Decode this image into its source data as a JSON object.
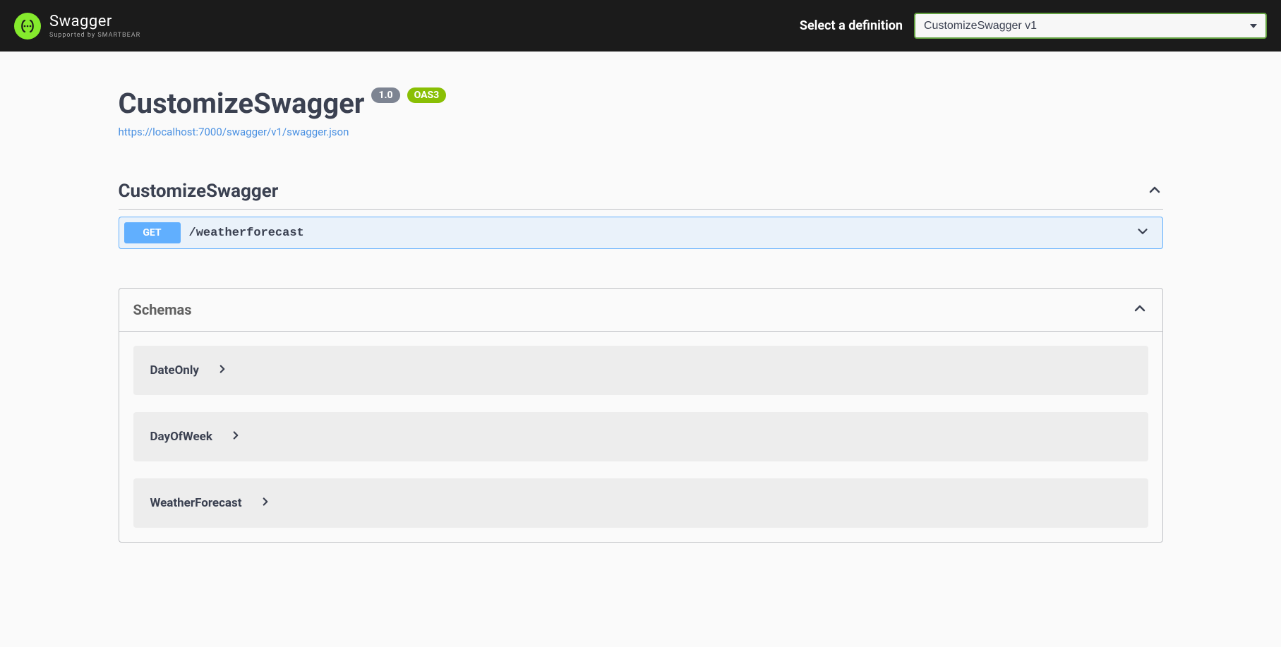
{
  "topbar": {
    "brand": "Swagger",
    "subBrand": "Supported by SMARTBEAR",
    "selectLabel": "Select a definition",
    "selectedDefinition": "CustomizeSwagger v1"
  },
  "info": {
    "title": "CustomizeSwagger",
    "version": "1.0",
    "oasLabel": "OAS3",
    "specUrl": "https://localhost:7000/swagger/v1/swagger.json"
  },
  "tag": {
    "name": "CustomizeSwagger",
    "operations": [
      {
        "method": "GET",
        "path": "/weatherforecast"
      }
    ]
  },
  "schemas": {
    "title": "Schemas",
    "items": [
      {
        "name": "DateOnly"
      },
      {
        "name": "DayOfWeek"
      },
      {
        "name": "WeatherForecast"
      }
    ]
  }
}
